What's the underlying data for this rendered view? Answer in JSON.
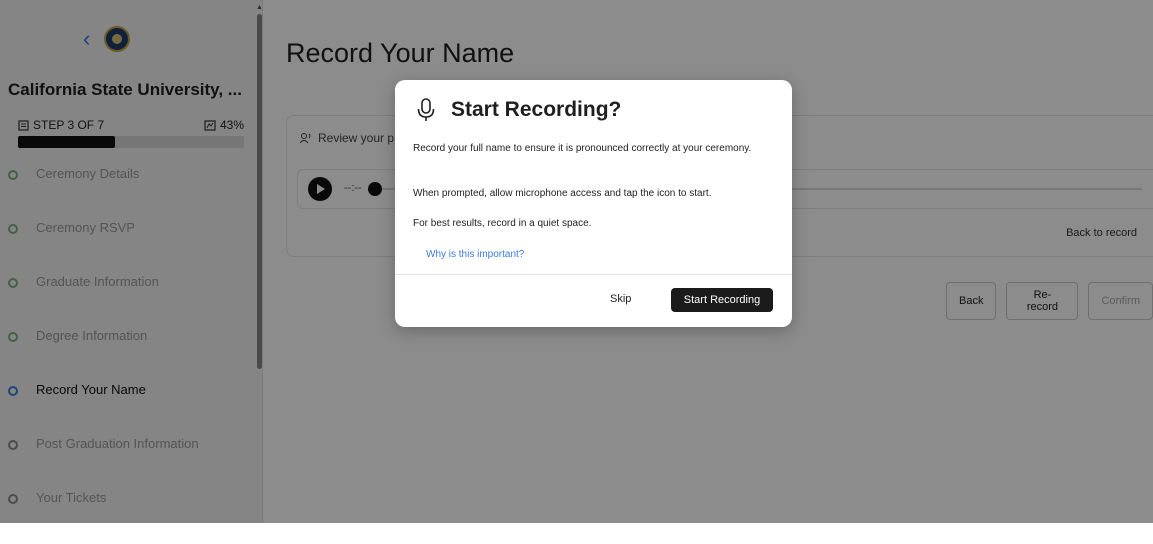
{
  "sidebar": {
    "back_icon": "chevron-left-icon",
    "school_name": "California State University, ...",
    "step_text": "STEP 3 OF 7",
    "progress_text": "43%",
    "progress_value": 0.43,
    "steps": [
      {
        "label": "Ceremony Details",
        "state": "done"
      },
      {
        "label": "Ceremony RSVP",
        "state": "done"
      },
      {
        "label": "Graduate Information",
        "state": "done"
      },
      {
        "label": "Degree Information",
        "state": "done"
      },
      {
        "label": "Record Your Name",
        "state": "current"
      },
      {
        "label": "Post Graduation Information",
        "state": "pending"
      },
      {
        "label": "Your Tickets",
        "state": "pending"
      }
    ]
  },
  "main": {
    "title": "Record Your Name",
    "review_text": "Review your p",
    "player_time": "--:--",
    "back_to_record": "Back to record",
    "buttons": {
      "back": "Back",
      "rerecord": "Re-record",
      "confirm": "Confirm"
    }
  },
  "modal": {
    "icon": "microphone-icon",
    "title": "Start Recording?",
    "paragraph1": "Record your full name to ensure it is pronounced correctly at your ceremony.",
    "paragraph2": "When prompted, allow microphone access and tap the icon to start.",
    "paragraph3": "For best results, record in a quiet space.",
    "link": "Why is this important?",
    "skip": "Skip",
    "start": "Start Recording"
  },
  "colors": {
    "accent": "#3b7be0",
    "done": "#7bb27d",
    "dark": "#1b1b1b"
  }
}
